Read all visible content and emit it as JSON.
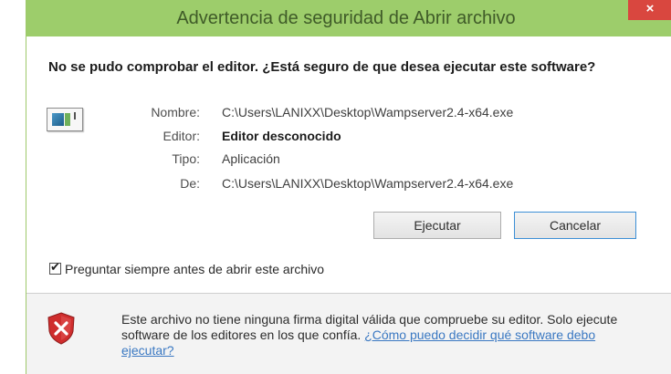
{
  "window": {
    "title": "Advertencia de seguridad de Abrir archivo",
    "close_label": "×"
  },
  "heading": "No se pudo comprobar el editor. ¿Está seguro de que desea ejecutar este software?",
  "file": {
    "icon": "executable-file-icon",
    "fields": [
      {
        "label": "Nombre:",
        "value": "C:\\Users\\LANIXX\\Desktop\\Wampserver2.4-x64.exe"
      },
      {
        "label": "Editor:",
        "value": "Editor desconocido"
      },
      {
        "label": "Tipo:",
        "value": "Aplicación"
      },
      {
        "label": "De:",
        "value": "C:\\Users\\LANIXX\\Desktop\\Wampserver2.4-x64.exe"
      }
    ]
  },
  "buttons": {
    "run": "Ejecutar",
    "cancel": "Cancelar"
  },
  "checkbox": {
    "label": "Preguntar siempre antes de abrir este archivo",
    "checked": true,
    "mark": "✔"
  },
  "warning": {
    "icon": "warning-shield-icon",
    "text": "Este archivo no tiene ninguna firma digital válida que compruebe su editor. Solo ejecute software de los editores en los que confía.",
    "link": "¿Cómo puedo decidir qué software debo ejecutar?"
  },
  "colors": {
    "titlebar": "#9dcd6b",
    "close": "#d9473f",
    "link": "#3a78c2",
    "footer": "#f3f3f3"
  }
}
